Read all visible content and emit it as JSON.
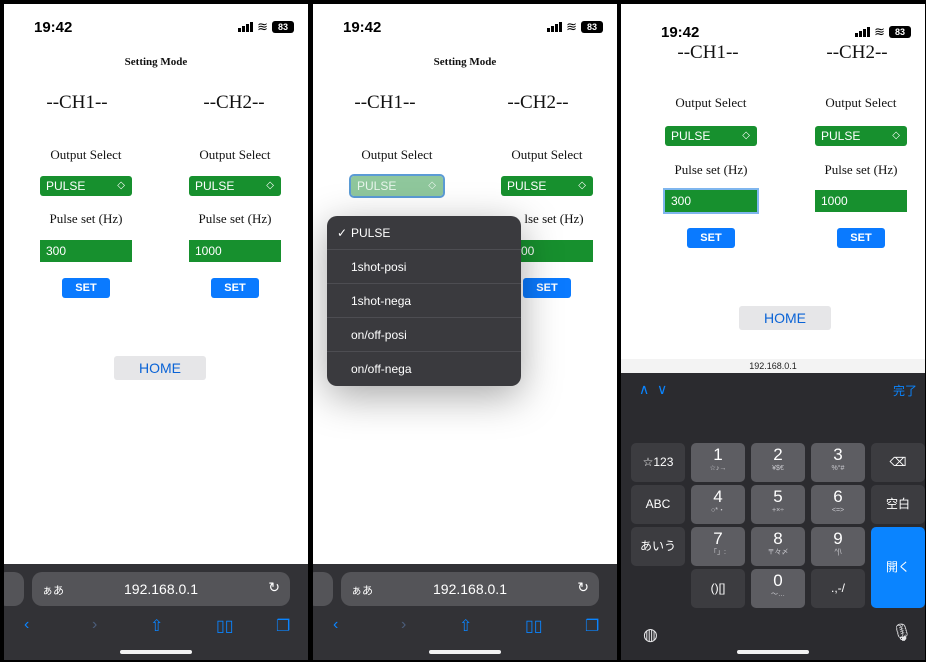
{
  "status": {
    "time": "19:42",
    "battery": "83"
  },
  "page": {
    "title": "Setting Mode",
    "ch1": {
      "title": "--CH1--",
      "output_label": "Output Select",
      "output_value": "PULSE",
      "pulse_label": "Pulse set (Hz)",
      "pulse_value": "300",
      "set_label": "SET"
    },
    "ch2": {
      "title": "--CH2--",
      "output_label": "Output Select",
      "output_value": "PULSE",
      "pulse_label": "Pulse set (Hz)",
      "pulse_value": "1000",
      "set_label": "SET"
    },
    "home_label": "HOME"
  },
  "browser": {
    "aa_label": "ぁあ",
    "url": "192.168.0.1"
  },
  "dropdown": {
    "options": [
      "PULSE",
      "1shot-posi",
      "1shot-nega",
      "on/off-posi",
      "on/off-nega"
    ],
    "selected": "PULSE",
    "peek": {
      "label_fragment": "lse set (Hz)",
      "value_fragment": "00"
    }
  },
  "keyboard": {
    "done_label": "完了",
    "left_keys": [
      "☆123",
      "ABC",
      "あいう"
    ],
    "right_keys": [
      "空白",
      "開く"
    ],
    "digits": [
      {
        "n": "1",
        "s": "☆♪→"
      },
      {
        "n": "2",
        "s": "¥$€"
      },
      {
        "n": "3",
        "s": "%°#"
      },
      {
        "n": "4",
        "s": "○*・"
      },
      {
        "n": "5",
        "s": "+×÷"
      },
      {
        "n": "6",
        "s": "<=>"
      },
      {
        "n": "7",
        "s": "「」:"
      },
      {
        "n": "8",
        "s": "〒々〆"
      },
      {
        "n": "9",
        "s": "^|\\"
      },
      {
        "n": "0",
        "s": "〜…"
      }
    ],
    "bottom_left": "()[]",
    "bottom_right": ".,-/"
  },
  "colors": {
    "green": "#17902e",
    "blue": "#0a7aff"
  }
}
